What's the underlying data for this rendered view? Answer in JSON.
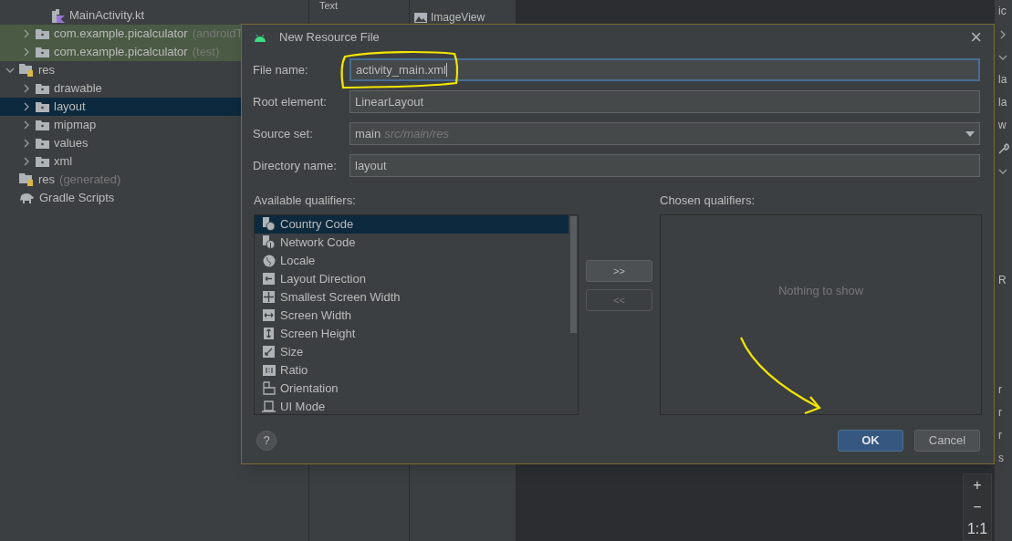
{
  "project_tree": [
    {
      "children": [
        {
          "children": [
            {
              "label": "MainActivity.kt",
              "kind": "file",
              "selected": false
            }
          ]
        },
        {
          "label": "com.example.picalculator",
          "hint": "(androidT",
          "kind": "folder",
          "expanded": false,
          "selected": false,
          "tinted": true
        },
        {
          "label": "com.example.picalculator",
          "hint": "(test)",
          "kind": "folder",
          "expanded": false,
          "selected": false,
          "tinted": true
        }
      ]
    },
    {
      "label": "res",
      "kind": "res",
      "expanded": true,
      "selected": false,
      "children": [
        {
          "label": "drawable",
          "kind": "folder",
          "expanded": false,
          "selected": false
        },
        {
          "label": "layout",
          "kind": "folder",
          "expanded": false,
          "selected": true
        },
        {
          "label": "mipmap",
          "kind": "folder",
          "expanded": false,
          "selected": false
        },
        {
          "label": "values",
          "kind": "folder",
          "expanded": false,
          "selected": false
        },
        {
          "label": "xml",
          "kind": "folder",
          "expanded": false,
          "selected": false
        }
      ]
    },
    {
      "label": "res",
      "hint": "(generated)",
      "kind": "res",
      "selected": false
    },
    {
      "label": "Gradle Scripts",
      "kind": "gradle",
      "selected": false
    }
  ],
  "palette": {
    "categories": [
      "Text"
    ],
    "widgets": [
      "ImageView"
    ]
  },
  "zoom_toolbar": [
    "+",
    "−",
    "1:1"
  ],
  "attributes_panel": [
    {
      "kind": "text",
      "label": "ic"
    },
    {
      "kind": "collapsed"
    },
    {
      "kind": "expanded"
    },
    {
      "kind": "text",
      "label": "la"
    },
    {
      "kind": "text",
      "label": "la"
    },
    {
      "kind": "text",
      "label": "w"
    },
    {
      "kind": "tool"
    },
    {
      "kind": "expanded"
    },
    {
      "kind": "gap"
    },
    {
      "kind": "text",
      "label": "R"
    },
    {
      "kind": "gap"
    },
    {
      "kind": "text",
      "label": "r"
    },
    {
      "kind": "text",
      "label": "r"
    },
    {
      "kind": "text",
      "label": "r"
    },
    {
      "kind": "text",
      "label": "s"
    }
  ],
  "dialog": {
    "title": "New Resource File",
    "close": "×",
    "fields": [
      {
        "label": "File name:",
        "kind": "text",
        "value": "activity_main.xml",
        "focused": true
      },
      {
        "label": "Root element:",
        "kind": "text",
        "value": "LinearLayout",
        "focused": false
      },
      {
        "label": "Source set:",
        "kind": "dropdown",
        "value": "main",
        "hint": "src/main/res",
        "focused": false
      },
      {
        "label": "Directory name:",
        "kind": "text",
        "value": "layout",
        "focused": false
      }
    ],
    "available_label": "Available qualifiers:",
    "available": [
      {
        "label": "Country Code",
        "selected": true
      },
      {
        "label": "Network Code",
        "selected": false
      },
      {
        "label": "Locale",
        "selected": false
      },
      {
        "label": "Layout Direction",
        "selected": false
      },
      {
        "label": "Smallest Screen Width",
        "selected": false
      },
      {
        "label": "Screen Width",
        "selected": false
      },
      {
        "label": "Screen Height",
        "selected": false
      },
      {
        "label": "Size",
        "selected": false
      },
      {
        "label": "Ratio",
        "selected": false
      },
      {
        "label": "Orientation",
        "selected": false
      },
      {
        "label": "UI Mode",
        "selected": false
      }
    ],
    "move_buttons": [
      {
        "label": ">>",
        "disabled": false
      },
      {
        "label": "<<",
        "disabled": true
      }
    ],
    "chosen_label": "Chosen qualifiers:",
    "chosen_empty": "Nothing to show",
    "help": "?",
    "buttons": [
      {
        "label": "OK",
        "primary": true
      },
      {
        "label": "Cancel",
        "primary": false
      }
    ]
  }
}
